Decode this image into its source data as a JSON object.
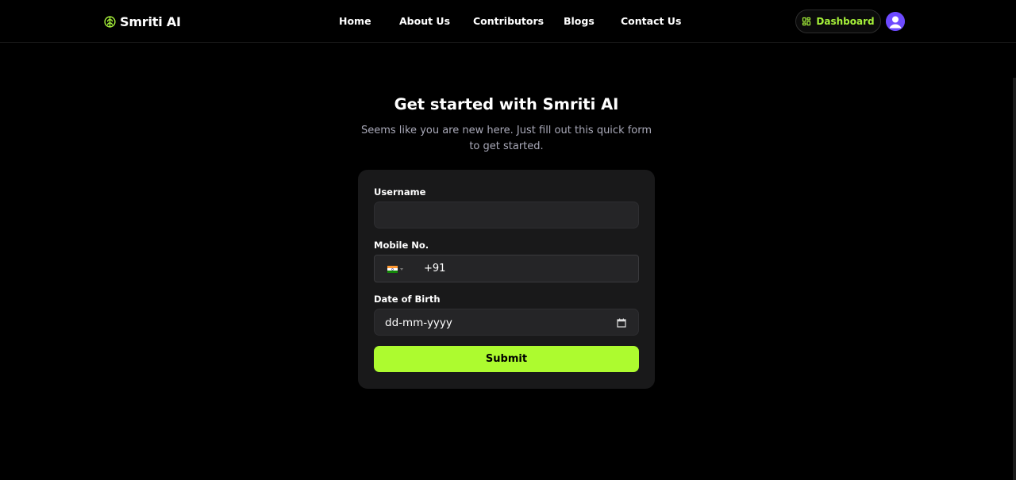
{
  "brand": {
    "name": "Smriti AI",
    "icon": "brain-icon",
    "accent": "#a7f23a"
  },
  "nav": {
    "links": [
      "Home",
      "About Us",
      "Contributors",
      "Blogs",
      "Contact Us"
    ],
    "dashboard_label": "Dashboard",
    "dashboard_icon": "grid-icon",
    "avatar_icon": "user-avatar-icon"
  },
  "main": {
    "title": "Get started with Smriti AI",
    "subtitle": "Seems like you are new here. Just fill out this quick form to get started."
  },
  "form": {
    "username": {
      "label": "Username",
      "value": ""
    },
    "mobile": {
      "label": "Mobile No.",
      "country_flag": "india-flag-icon",
      "value": "+91"
    },
    "dob": {
      "label": "Date of Birth",
      "placeholder": "dd-mm-yyyy",
      "icon": "calendar-icon"
    },
    "submit_label": "Submit",
    "submit_color": "#adfb2f"
  }
}
